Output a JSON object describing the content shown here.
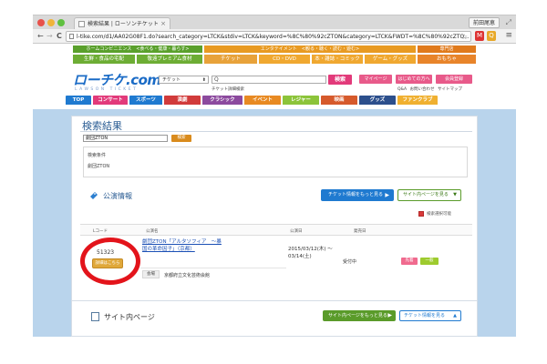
{
  "browser": {
    "tab_title": "検索結果 | ローソンチケット",
    "tab_close": "×",
    "profile_button": "前田尾恵",
    "fullscreen_icon": "⤢",
    "back_icon": "←",
    "forward_icon": "→",
    "reload_icon": "C",
    "url": "l-tike.com/d1/AA02G08F1.do?search_category=LTCK&stdiv=LTCK&keyword=%8C%80%92cZTON&category=LTCK&FWDT=%8C%80%92cZTO...",
    "star_icon": "☆",
    "ext1": "M",
    "ext2": "Q",
    "menu_icon": "≡"
  },
  "site": {
    "top_categories": [
      {
        "label": "ホームコンビニエンス　<食べる・健康・暮らす>",
        "color": "#5aa02c"
      },
      {
        "label": "エンタテイメント　<観る・聴く・読む・遊む>",
        "color": "#e89a22"
      },
      {
        "label": "専門店",
        "color": "#e07a1c"
      }
    ],
    "sub_categories": [
      {
        "label": "生鮮・食品の宅配",
        "color": "#6dad34"
      },
      {
        "label": "敬遠プレミアム食材",
        "color": "#6dad34"
      },
      {
        "label": "チケット",
        "color": "#e8a23a"
      },
      {
        "label": "CD・DVD",
        "color": "#f0a830"
      },
      {
        "label": "本・雑誌・コミック",
        "color": "#f0a830"
      },
      {
        "label": "ゲーム・グッズ",
        "color": "#f0a830"
      },
      {
        "label": "おもちゃ",
        "color": "#e8842a"
      }
    ],
    "logo": "ローチケ.com",
    "logo_sub": "LAWSON TICKET",
    "select_value": "チケット",
    "search_icon": "Q",
    "search_button": "検索",
    "header_buttons": [
      {
        "label": "マイページ",
        "color": "#e85a8a"
      },
      {
        "label": "はじめての方へ",
        "color": "#e85a8a"
      },
      {
        "label": "会員登録",
        "color": "#e85a8a"
      }
    ],
    "detail_search": "チケット詳細検索",
    "help_links": "Q&A お問い合わせ サイトマップ",
    "nav": [
      {
        "label": "TOP",
        "color": "#1f7ad0"
      },
      {
        "label": "コンサート",
        "color": "#e23a7a"
      },
      {
        "label": "スポーツ",
        "color": "#1f7ad0"
      },
      {
        "label": "演劇",
        "color": "#d13b3b"
      },
      {
        "label": "クラシック",
        "color": "#8c4a9e"
      },
      {
        "label": "イベント",
        "color": "#e88a22"
      },
      {
        "label": "レジャー",
        "color": "#8cc43a"
      },
      {
        "label": "映画",
        "color": "#d65a2c"
      },
      {
        "label": "グッズ",
        "color": "#2c4f8c"
      },
      {
        "label": "ファンクラブ",
        "color": "#f0b030"
      }
    ]
  },
  "results": {
    "title": "検索結果",
    "keyword": "劇団ZTON",
    "keyword_button": "検索",
    "conditions_label": "検索条件",
    "conditions_value": "劇団ZTON"
  },
  "performance": {
    "title": "公演情報",
    "button_more": "チケット情報をもっと見る",
    "button_site": "サイト内ページを見る",
    "return_label": "検索選択可能",
    "columns": [
      "Lコード",
      "公演名",
      "公演日",
      "発売日"
    ],
    "row": {
      "code": "51323",
      "detail_button": "詳細はこちら",
      "name": "劇団ZTON「アルタソフィア　～暴国の革命因子」（京都）",
      "venue_tag": "会場",
      "venue": "京都府立文化芸術会館",
      "date": "2015/03/12(木) ～\n03/14(土)",
      "status": "受付中",
      "badge1": "先着",
      "badge2": "一般"
    }
  },
  "site_pages": {
    "title": "サイト内ページ",
    "button_more": "サイト内ページをもっと見る",
    "button_ticket": "チケット情報を見る"
  }
}
